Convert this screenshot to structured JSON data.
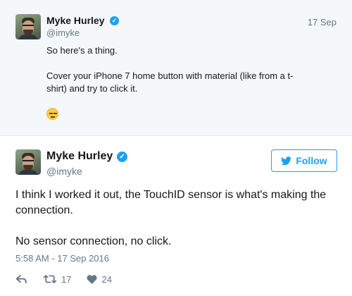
{
  "quoted_tweet": {
    "author_name": "Myke Hurley",
    "handle": "@imyke",
    "date": "17 Sep",
    "lines": [
      "So here's a thing.",
      "Cover your iPhone 7 home button with material (like from a t-",
      "shirt) and try to click it."
    ],
    "emoji": "expressionless-face"
  },
  "main_tweet": {
    "author_name": "Myke Hurley",
    "handle": "@imyke",
    "follow_label": "Follow",
    "lines": [
      "I think I worked it out, the TouchID sensor is what's making the",
      "connection.",
      "No sensor connection, no click."
    ],
    "timestamp": "5:58 AM - 17 Sep 2016",
    "retweet_count": "17",
    "like_count": "24"
  },
  "colors": {
    "twitter_blue": "#1da1f2",
    "muted_text": "#657786",
    "top_background": "#f5f8fa"
  },
  "icons": [
    "verified-icon",
    "twitter-bird-icon",
    "reply-icon",
    "retweet-icon",
    "like-icon"
  ]
}
